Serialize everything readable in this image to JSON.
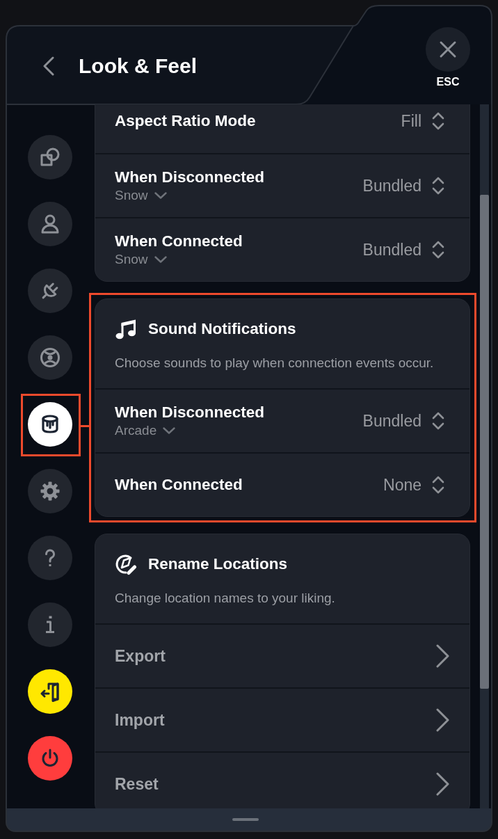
{
  "header": {
    "title": "Look & Feel",
    "close_label": "ESC"
  },
  "sidebar": {
    "items": [
      {
        "selected": false,
        "highlighted": false,
        "color": "#22262e"
      },
      {
        "selected": false,
        "highlighted": false,
        "color": "#22262e"
      },
      {
        "selected": false,
        "highlighted": false,
        "color": "#22262e"
      },
      {
        "selected": false,
        "highlighted": false,
        "color": "#22262e"
      },
      {
        "selected": true,
        "highlighted": true,
        "color": "#ffffff"
      },
      {
        "selected": false,
        "highlighted": false,
        "color": "#22262e"
      },
      {
        "selected": false,
        "highlighted": false,
        "color": "#22262e"
      },
      {
        "selected": false,
        "highlighted": false,
        "color": "#22262e"
      },
      {
        "selected": false,
        "highlighted": false,
        "color": "#ffe800"
      },
      {
        "selected": false,
        "highlighted": false,
        "color": "#ff3d3d"
      }
    ]
  },
  "cards": [
    {
      "highlighted": false,
      "rows": [
        {
          "kind": "select",
          "label": "Aspect Ratio Mode",
          "value": "Fill"
        },
        {
          "kind": "select",
          "label": "When Disconnected",
          "option": "Snow",
          "value": "Bundled"
        },
        {
          "kind": "select",
          "label": "When Connected",
          "option": "Snow",
          "value": "Bundled"
        }
      ]
    },
    {
      "highlighted": true,
      "title": "Sound Notifications",
      "description": "Choose sounds to play when connection events occur.",
      "rows": [
        {
          "kind": "select",
          "label": "When Disconnected",
          "option": "Arcade",
          "value": "Bundled"
        },
        {
          "kind": "select",
          "label": "When Connected",
          "value": "None"
        }
      ]
    },
    {
      "highlighted": false,
      "title": "Rename Locations",
      "description": "Change location names to your liking.",
      "rows": [
        {
          "kind": "link",
          "label": "Export"
        },
        {
          "kind": "link",
          "label": "Import"
        },
        {
          "kind": "link",
          "label": "Reset"
        }
      ]
    }
  ]
}
